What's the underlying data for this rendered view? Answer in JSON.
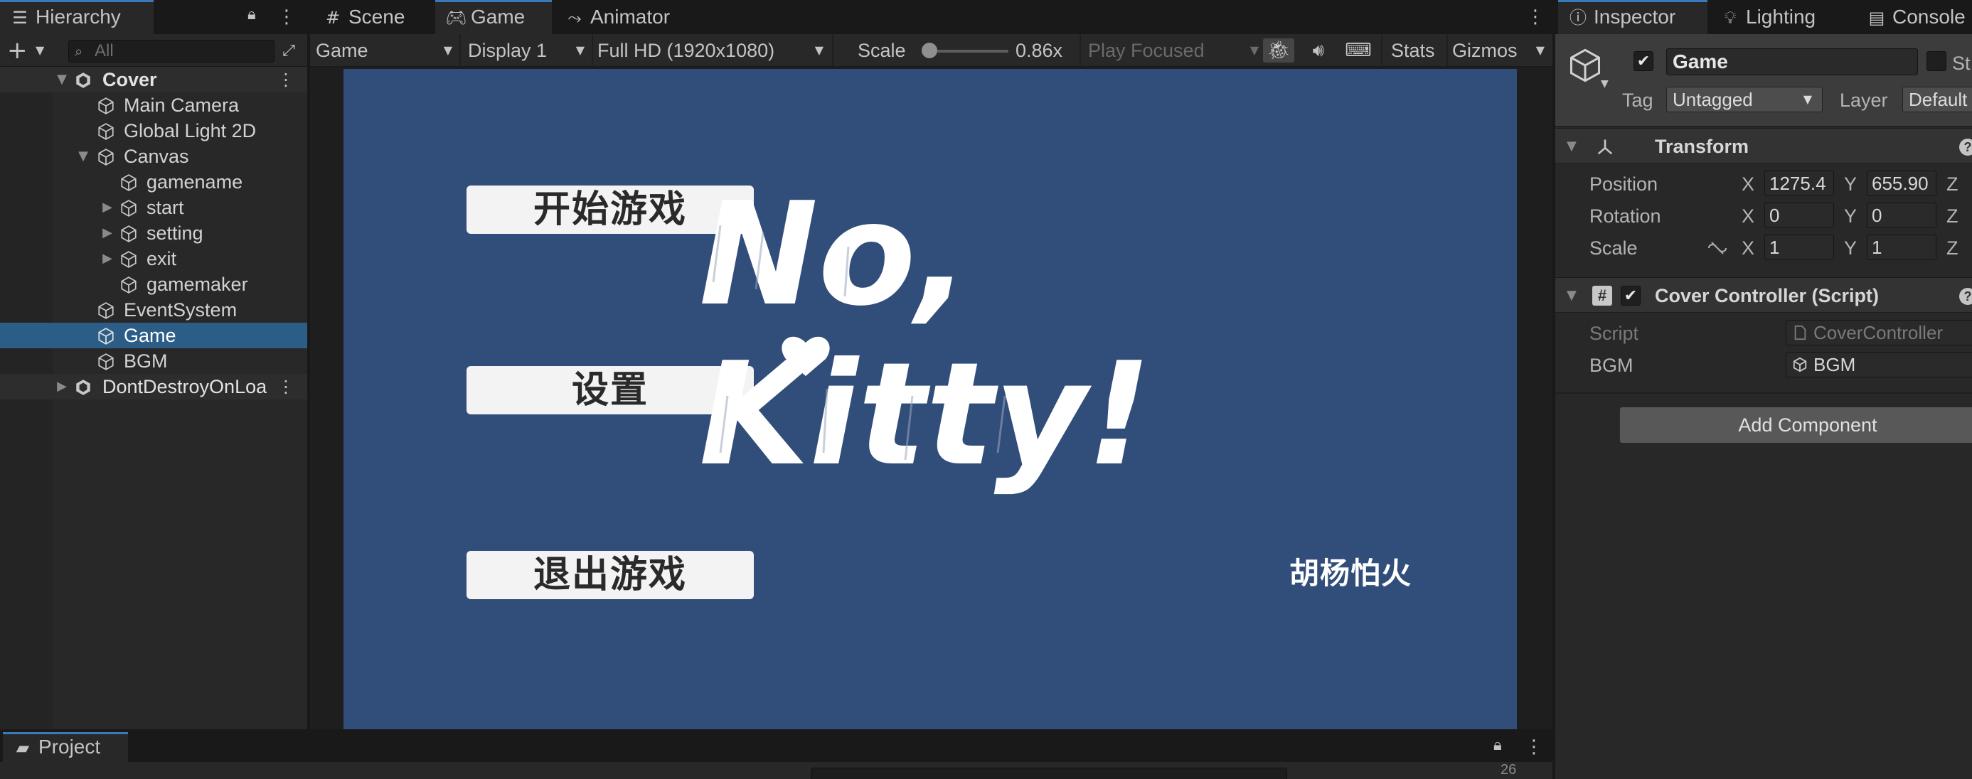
{
  "hierarchy": {
    "tab_label": "Hierarchy",
    "search_placeholder": "All",
    "items": [
      {
        "label": "Cover"
      },
      {
        "label": "Main Camera"
      },
      {
        "label": "Global Light 2D"
      },
      {
        "label": "Canvas"
      },
      {
        "label": "gamename"
      },
      {
        "label": "start"
      },
      {
        "label": "setting"
      },
      {
        "label": "exit"
      },
      {
        "label": "gamemaker"
      },
      {
        "label": "EventSystem"
      },
      {
        "label": "Game"
      },
      {
        "label": "BGM"
      },
      {
        "label": "DontDestroyOnLoa"
      }
    ]
  },
  "center_tabs": {
    "scene": "Scene",
    "game": "Game",
    "animator": "Animator"
  },
  "game_toolbar": {
    "view_select": "Game",
    "display": "Display 1",
    "resolution": "Full HD (1920x1080)",
    "scale_label": "Scale",
    "scale_value": "0.86x",
    "scale_fraction": 0.0,
    "play_mode": "Play Focused",
    "stats": "Stats",
    "gizmos": "Gizmos"
  },
  "game_screen": {
    "background": "#314d7a",
    "buttons": {
      "start": "开始游戏",
      "settings": "设置",
      "exit": "退出游戏"
    },
    "logo_line1": "No,",
    "logo_line2": "Kitty!",
    "author": "胡杨怕火"
  },
  "inspector": {
    "tabs": {
      "inspector": "Inspector",
      "lighting": "Lighting",
      "console": "Console"
    },
    "object_name": "Game",
    "static_label": "St",
    "tag_label": "Tag",
    "tag_value": "Untagged",
    "layer_label": "Layer",
    "layer_value": "Default",
    "transform": {
      "title": "Transform",
      "position_label": "Position",
      "rotation_label": "Rotation",
      "scale_label": "Scale",
      "axis_x": "X",
      "axis_y": "Y",
      "axis_z": "Z",
      "position": {
        "x": "1275.4",
        "y": "655.90"
      },
      "rotation": {
        "x": "0",
        "y": "0"
      },
      "scale": {
        "x": "1",
        "y": "1"
      }
    },
    "cover_controller": {
      "title": "Cover Controller (Script)",
      "script_label": "Script",
      "script_value": "CoverController",
      "bgm_label": "BGM",
      "bgm_value": "BGM"
    },
    "add_component": "Add Component"
  },
  "project": {
    "tab_label": "Project",
    "count": "26"
  }
}
